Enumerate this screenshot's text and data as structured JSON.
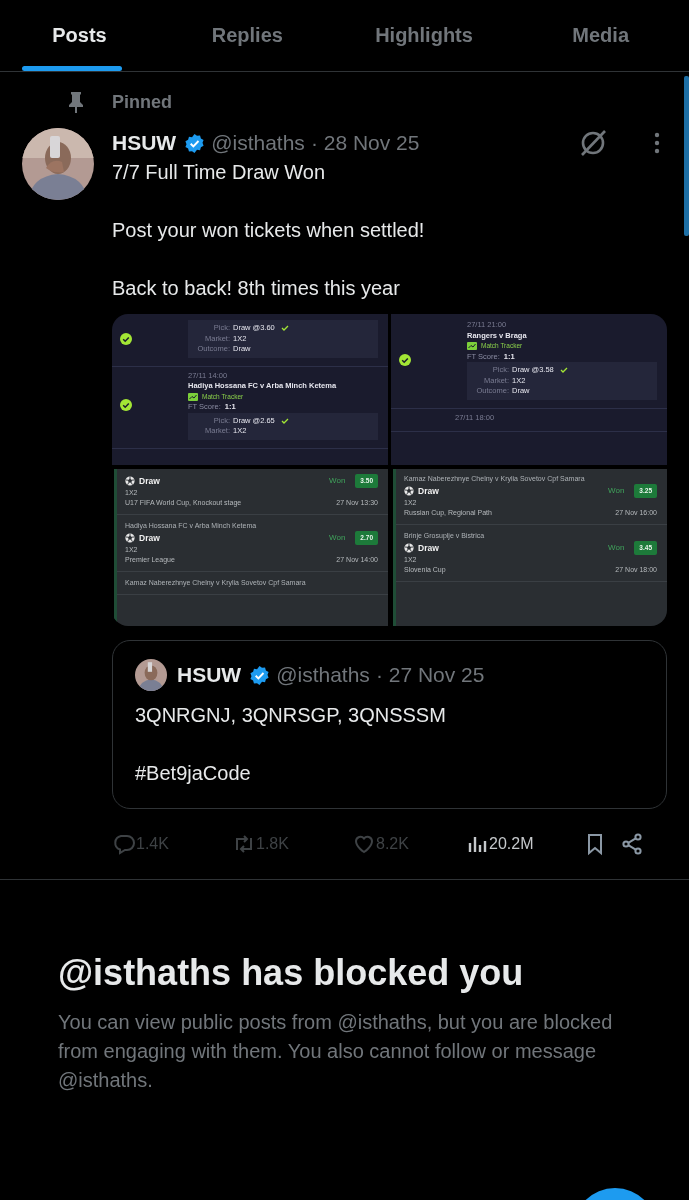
{
  "tabs": [
    {
      "label": "Posts",
      "selected": true
    },
    {
      "label": "Replies",
      "selected": false
    },
    {
      "label": "Highlights",
      "selected": false
    },
    {
      "label": "Media",
      "selected": false
    }
  ],
  "pinned": {
    "label": "Pinned"
  },
  "post": {
    "name": "HSUW",
    "verified": true,
    "handle": "@isthaths",
    "date": "· 28 Nov 25",
    "lines": [
      "7/7 Full Time Draw Won",
      "Post your won tickets when settled!",
      "Back to back! 8th times this year"
    ],
    "media": [
      {
        "kind": "tracker",
        "entries": [
          {
            "fields": [
              {
                "label": "Pick:",
                "value": "Draw @3.60",
                "tick": true
              },
              {
                "label": "Market:",
                "value": "1X2",
                "tick": false
              },
              {
                "label": "Outcome:",
                "value": "Draw",
                "tick": false
              }
            ]
          },
          {
            "date": "27/11 14:00",
            "match": "Hadiya Hossana FC v Arba Minch Ketema",
            "tracker": "Match Tracker",
            "score_label": "FT Score:",
            "score": "1:1",
            "fields": [
              {
                "label": "Pick:",
                "value": "Draw @2.65",
                "tick": true
              },
              {
                "label": "Market:",
                "value": "1X2",
                "tick": false
              }
            ]
          }
        ]
      },
      {
        "kind": "tracker",
        "entries": [
          {
            "date": "27/11 21:00",
            "match": "Rangers v Braga",
            "tracker": "Match Tracker",
            "score_label": "FT Score:",
            "score": "1:1",
            "fields": [
              {
                "label": "Pick:",
                "value": "Draw @3.58",
                "tick": true
              },
              {
                "label": "Market:",
                "value": "1X2",
                "tick": false
              },
              {
                "label": "Outcome:",
                "value": "Draw",
                "tick": false
              }
            ]
          },
          {
            "date": "27/11 18:00"
          }
        ]
      },
      {
        "kind": "betslip",
        "entries": [
          {
            "pick": "Draw",
            "status": "Won",
            "odds": "3.50",
            "market": "1X2",
            "competition": "U17 FIFA World Cup, Knockout stage",
            "time": "27 Nov 13:30"
          },
          {
            "match": "Hadiya Hossana FC v Arba Minch Ketema",
            "pick": "Draw",
            "status": "Won",
            "odds": "2.70",
            "market": "1X2",
            "competition": "Premier League",
            "time": "27 Nov 14:00"
          },
          {
            "match": "Kamaz Naberezhnye Chelny v Krylia Sovetov Cpf Samara"
          }
        ]
      },
      {
        "kind": "betslip",
        "entries": [
          {
            "match": "Kamaz Naberezhnye Chelny v Krylia Sovetov Cpf Samara",
            "pick": "Draw",
            "status": "Won",
            "odds": "3.25",
            "market": "1X2",
            "competition": "Russian Cup, Regional Path",
            "time": "27 Nov 16:00"
          },
          {
            "match": "Brinje Grosuplje v Bistrica",
            "pick": "Draw",
            "status": "Won",
            "odds": "3.45",
            "market": "1X2",
            "competition": "Slovenia Cup",
            "time": "27 Nov 18:00"
          }
        ]
      }
    ],
    "quote": {
      "name": "HSUW",
      "verified": true,
      "handle": "@isthaths",
      "date": "· 27 Nov 25",
      "lines": [
        "3QNRGNJ, 3QNRSGP, 3QNSSSM",
        "#Bet9jaCode"
      ]
    },
    "actions": [
      {
        "kind": "reply",
        "count": "1.4K",
        "disabled": true
      },
      {
        "kind": "repost",
        "count": "1.8K",
        "disabled": true
      },
      {
        "kind": "like",
        "count": "8.2K",
        "disabled": true
      },
      {
        "kind": "views",
        "count": "20.2M",
        "disabled": false
      },
      {
        "kind": "bookmark",
        "disabled": false
      },
      {
        "kind": "share",
        "disabled": false
      }
    ]
  },
  "blocked": {
    "title": "@isthaths has blocked you",
    "text": "You can view public posts from @isthaths, but you are blocked from engaging with them. You also cannot follow or message @isthaths."
  }
}
